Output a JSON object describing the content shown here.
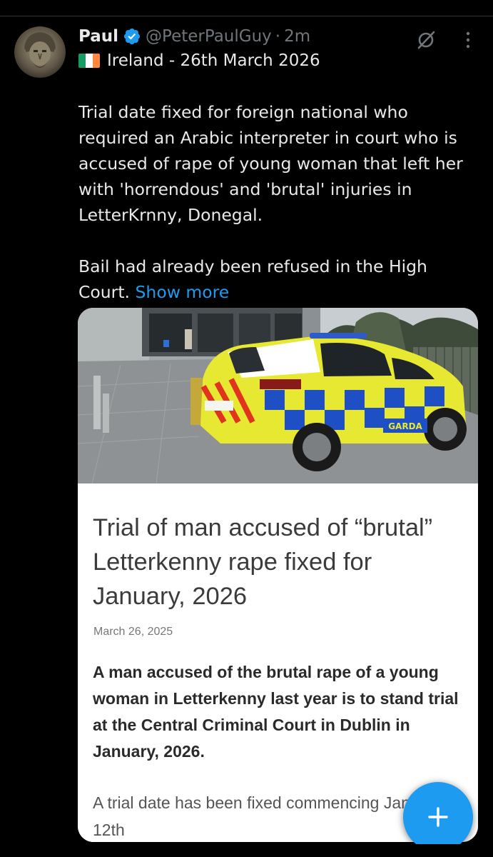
{
  "tweet": {
    "author_name": "Paul",
    "handle": "@PeterPaulGuy",
    "separator": "·",
    "time": "2m",
    "location_line": "Ireland - 26th March 2026",
    "body_paragraph_1": "Trial date fixed for foreign national who required an Arabic interpreter in court who is accused of rape of young woman that left her with 'horrendous' and 'brutal' injuries in LetterKrnny, Donegal.",
    "body_paragraph_2": "Bail had already been refused in the High Court.",
    "show_more_label": "Show more",
    "icons": {
      "verified": "verified-badge-icon",
      "grok": "grok-icon",
      "more": "more-options-icon",
      "flag": "ireland-flag-icon"
    }
  },
  "card": {
    "image_label": "GARDA",
    "title": "Trial of man accused of “brutal” Letterkenny rape fixed for January, 2026",
    "date": "March 26, 2025",
    "lead": "A man accused of the brutal rape of a young woman in Letterkenny last year is to stand trial at the Central Criminal Court in Dublin in January, 2026.",
    "body": "A trial date has been fixed commencing January 12th"
  },
  "fab": {
    "icon": "plus-icon"
  },
  "colors": {
    "background": "#000000",
    "text_primary": "#e7e9ea",
    "text_secondary": "#71767b",
    "accent": "#1d9bf0"
  }
}
